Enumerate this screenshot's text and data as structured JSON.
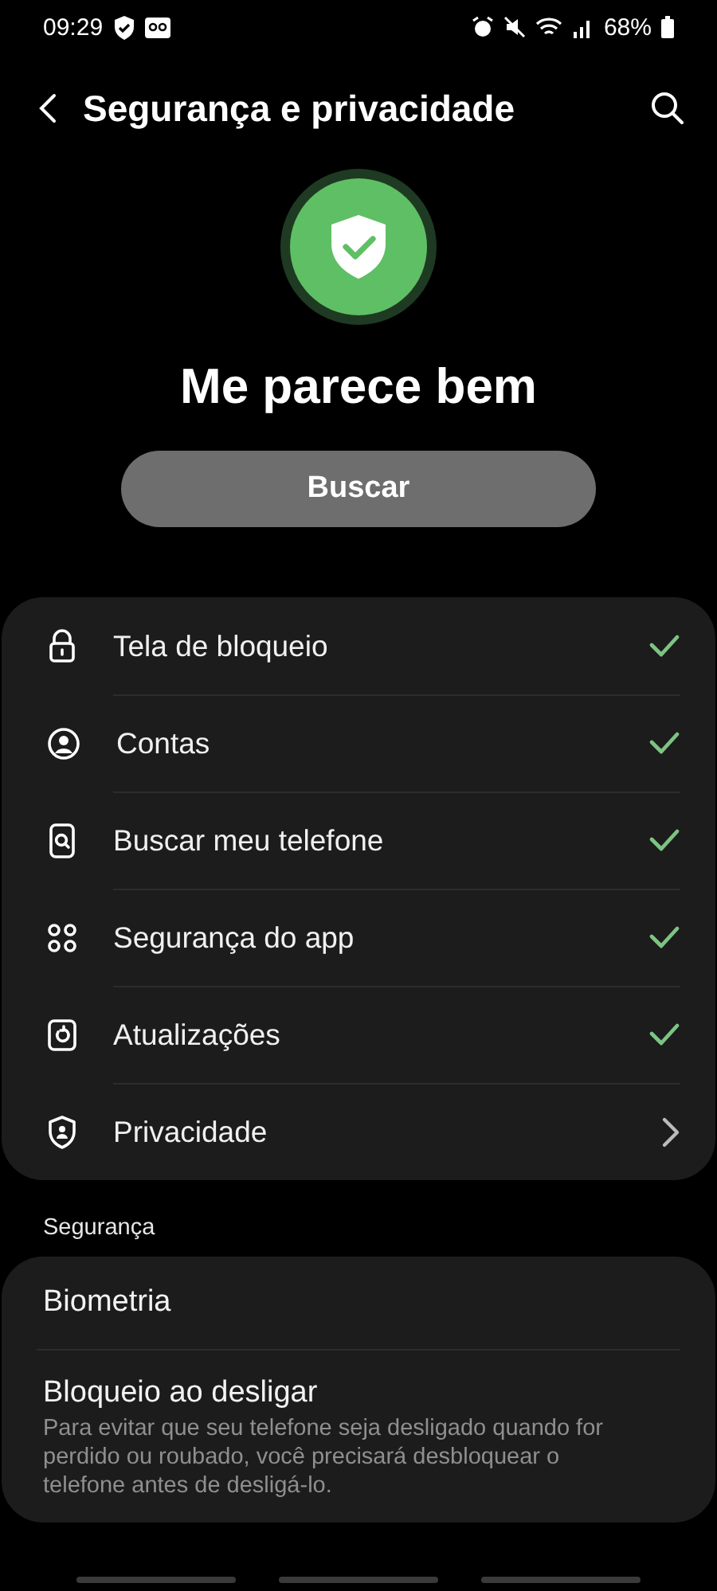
{
  "status_bar": {
    "time": "09:29",
    "battery": "68%"
  },
  "header": {
    "title": "Segurança e privacidade"
  },
  "summary": {
    "status": "Me parece bem",
    "button": "Buscar"
  },
  "items": [
    {
      "label": "Tela de bloqueio",
      "kind": "check"
    },
    {
      "label": "Contas",
      "kind": "check"
    },
    {
      "label": "Buscar meu telefone",
      "kind": "check"
    },
    {
      "label": "Segurança do app",
      "kind": "check"
    },
    {
      "label": "Atualizações",
      "kind": "check"
    },
    {
      "label": "Privacidade",
      "kind": "link"
    }
  ],
  "section": {
    "title": "Segurança",
    "items": [
      {
        "title": "Biometria"
      },
      {
        "title": "Bloqueio ao desligar",
        "description": "Para evitar que seu telefone seja desligado quando for perdido ou roubado, você precisará desbloquear o telefone antes de desligá-lo."
      }
    ]
  }
}
